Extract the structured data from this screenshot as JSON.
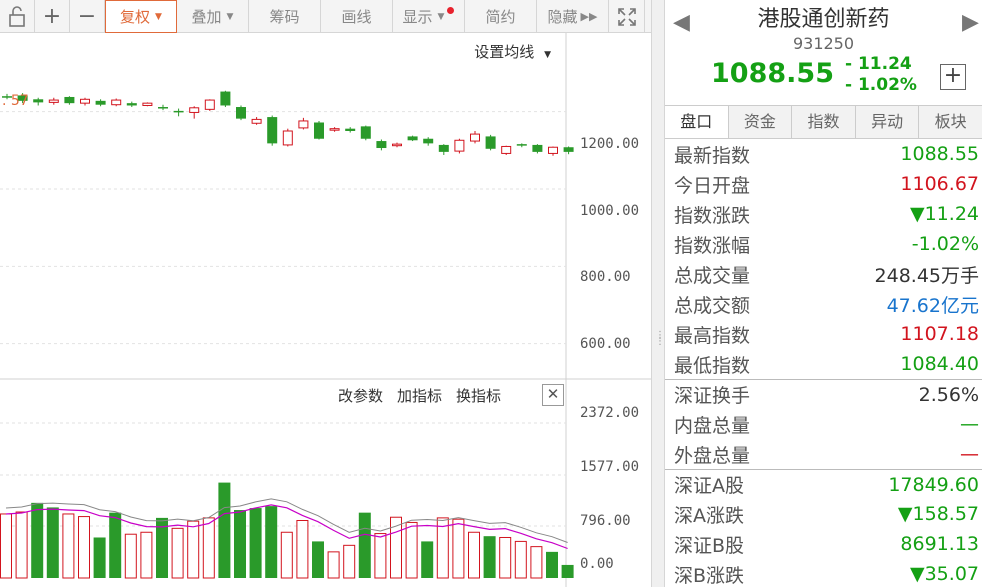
{
  "toolbar": {
    "fuquan": "复权",
    "diejia": "叠加",
    "chouma": "筹码",
    "huaxian": "画线",
    "xianshi": "显示",
    "jianyue": "简约",
    "yincang": "隐藏"
  },
  "chart": {
    "ma_setting": "设置均线",
    "last_price_label": ". 57",
    "indicator_buttons": [
      "改参数",
      "加指标",
      "换指标"
    ],
    "price_axis": [
      "1200.00",
      "1000.00",
      "800.00",
      "600.00"
    ],
    "volume_axis": [
      "2372.00",
      "1577.00",
      "796.00",
      "0.00"
    ]
  },
  "chart_data": {
    "type": "candlestick",
    "price_ylim": [
      550,
      1300
    ],
    "volume_ylim": [
      0,
      2372
    ],
    "candles": [
      {
        "o": 1240,
        "c": 1238,
        "h": 1246,
        "l": 1232,
        "dir": "down"
      },
      {
        "o": 1242,
        "c": 1228,
        "h": 1248,
        "l": 1222,
        "dir": "down"
      },
      {
        "o": 1232,
        "c": 1224,
        "h": 1236,
        "l": 1216,
        "dir": "down"
      },
      {
        "o": 1224,
        "c": 1230,
        "h": 1236,
        "l": 1218,
        "dir": "up"
      },
      {
        "o": 1238,
        "c": 1222,
        "h": 1240,
        "l": 1218,
        "dir": "down"
      },
      {
        "o": 1222,
        "c": 1232,
        "h": 1236,
        "l": 1216,
        "dir": "up"
      },
      {
        "o": 1228,
        "c": 1218,
        "h": 1232,
        "l": 1214,
        "dir": "down"
      },
      {
        "o": 1218,
        "c": 1230,
        "h": 1234,
        "l": 1214,
        "dir": "up"
      },
      {
        "o": 1222,
        "c": 1216,
        "h": 1226,
        "l": 1212,
        "dir": "down"
      },
      {
        "o": 1216,
        "c": 1222,
        "h": 1224,
        "l": 1214,
        "dir": "up"
      },
      {
        "o": 1212,
        "c": 1210,
        "h": 1218,
        "l": 1204,
        "dir": "down"
      },
      {
        "o": 1200,
        "c": 1202,
        "h": 1208,
        "l": 1188,
        "dir": "down"
      },
      {
        "o": 1198,
        "c": 1210,
        "h": 1214,
        "l": 1182,
        "dir": "up"
      },
      {
        "o": 1206,
        "c": 1230,
        "h": 1232,
        "l": 1202,
        "dir": "up"
      },
      {
        "o": 1216,
        "c": 1252,
        "h": 1254,
        "l": 1212,
        "dir": "down"
      },
      {
        "o": 1212,
        "c": 1182,
        "h": 1216,
        "l": 1178,
        "dir": "down"
      },
      {
        "o": 1170,
        "c": 1180,
        "h": 1186,
        "l": 1166,
        "dir": "up"
      },
      {
        "o": 1186,
        "c": 1118,
        "h": 1190,
        "l": 1112,
        "dir": "down"
      },
      {
        "o": 1114,
        "c": 1150,
        "h": 1156,
        "l": 1110,
        "dir": "up"
      },
      {
        "o": 1158,
        "c": 1176,
        "h": 1184,
        "l": 1154,
        "dir": "up"
      },
      {
        "o": 1172,
        "c": 1130,
        "h": 1176,
        "l": 1128,
        "dir": "down"
      },
      {
        "o": 1154,
        "c": 1156,
        "h": 1160,
        "l": 1148,
        "dir": "up"
      },
      {
        "o": 1156,
        "c": 1150,
        "h": 1160,
        "l": 1146,
        "dir": "down"
      },
      {
        "o": 1162,
        "c": 1130,
        "h": 1164,
        "l": 1126,
        "dir": "down"
      },
      {
        "o": 1124,
        "c": 1106,
        "h": 1128,
        "l": 1100,
        "dir": "down"
      },
      {
        "o": 1112,
        "c": 1116,
        "h": 1120,
        "l": 1108,
        "dir": "up"
      },
      {
        "o": 1136,
        "c": 1126,
        "h": 1138,
        "l": 1124,
        "dir": "down"
      },
      {
        "o": 1130,
        "c": 1118,
        "h": 1134,
        "l": 1112,
        "dir": "down"
      },
      {
        "o": 1114,
        "c": 1096,
        "h": 1116,
        "l": 1088,
        "dir": "down"
      },
      {
        "o": 1098,
        "c": 1126,
        "h": 1130,
        "l": 1092,
        "dir": "up"
      },
      {
        "o": 1124,
        "c": 1142,
        "h": 1150,
        "l": 1118,
        "dir": "up"
      },
      {
        "o": 1136,
        "c": 1104,
        "h": 1140,
        "l": 1100,
        "dir": "down"
      },
      {
        "o": 1092,
        "c": 1110,
        "h": 1112,
        "l": 1088,
        "dir": "up"
      },
      {
        "o": 1114,
        "c": 1116,
        "h": 1118,
        "l": 1108,
        "dir": "down"
      },
      {
        "o": 1114,
        "c": 1096,
        "h": 1116,
        "l": 1092,
        "dir": "down"
      },
      {
        "o": 1092,
        "c": 1108,
        "h": 1110,
        "l": 1086,
        "dir": "up"
      },
      {
        "o": 1096,
        "c": 1108,
        "h": 1110,
        "l": 1090,
        "dir": "down"
      }
    ],
    "volumes": [
      {
        "v": 980,
        "dir": "up"
      },
      {
        "v": 1010,
        "dir": "up"
      },
      {
        "v": 1150,
        "dir": "down"
      },
      {
        "v": 1080,
        "dir": "down"
      },
      {
        "v": 980,
        "dir": "up"
      },
      {
        "v": 940,
        "dir": "up"
      },
      {
        "v": 620,
        "dir": "down"
      },
      {
        "v": 1000,
        "dir": "down"
      },
      {
        "v": 670,
        "dir": "up"
      },
      {
        "v": 700,
        "dir": "up"
      },
      {
        "v": 920,
        "dir": "down"
      },
      {
        "v": 760,
        "dir": "up"
      },
      {
        "v": 870,
        "dir": "up"
      },
      {
        "v": 920,
        "dir": "up"
      },
      {
        "v": 1460,
        "dir": "down"
      },
      {
        "v": 1040,
        "dir": "down"
      },
      {
        "v": 1070,
        "dir": "down"
      },
      {
        "v": 1100,
        "dir": "down"
      },
      {
        "v": 700,
        "dir": "up"
      },
      {
        "v": 880,
        "dir": "up"
      },
      {
        "v": 560,
        "dir": "down"
      },
      {
        "v": 400,
        "dir": "up"
      },
      {
        "v": 500,
        "dir": "up"
      },
      {
        "v": 1000,
        "dir": "down"
      },
      {
        "v": 680,
        "dir": "up"
      },
      {
        "v": 930,
        "dir": "up"
      },
      {
        "v": 850,
        "dir": "up"
      },
      {
        "v": 560,
        "dir": "down"
      },
      {
        "v": 920,
        "dir": "up"
      },
      {
        "v": 900,
        "dir": "up"
      },
      {
        "v": 700,
        "dir": "up"
      },
      {
        "v": 640,
        "dir": "down"
      },
      {
        "v": 620,
        "dir": "up"
      },
      {
        "v": 560,
        "dir": "up"
      },
      {
        "v": 480,
        "dir": "up"
      },
      {
        "v": 400,
        "dir": "down"
      },
      {
        "v": 200,
        "dir": "down"
      }
    ]
  },
  "panel": {
    "title": "港股通创新药",
    "code": "931250",
    "price": "1088.55",
    "change": "- 11.24",
    "change_pct": "- 1.02%",
    "tabs": [
      "盘口",
      "资金",
      "指数",
      "异动",
      "板块"
    ],
    "rows": [
      {
        "label": "最新指数",
        "value": "1088.55",
        "color": "green"
      },
      {
        "label": "今日开盘",
        "value": "1106.67",
        "color": "red"
      },
      {
        "label": "指数涨跌",
        "value": "▼11.24",
        "color": "green"
      },
      {
        "label": "指数涨幅",
        "value": "-1.02%",
        "color": "green"
      },
      {
        "label": "总成交量",
        "value": "248.45万手",
        "color": "dark"
      },
      {
        "label": "总成交额",
        "value": "47.62亿元",
        "color": "blue"
      },
      {
        "label": "最高指数",
        "value": "1107.18",
        "color": "red"
      },
      {
        "label": "最低指数",
        "value": "1084.40",
        "color": "green"
      },
      {
        "label": "深证换手",
        "value": "2.56%",
        "color": "dark",
        "sep": true
      },
      {
        "label": "内盘总量",
        "value": "—",
        "color": "green"
      },
      {
        "label": "外盘总量",
        "value": "—",
        "color": "red"
      },
      {
        "label": "深证A股",
        "value": "17849.60",
        "color": "green",
        "sep": true
      },
      {
        "label": "深A涨跌",
        "value": "▼158.57",
        "color": "green"
      },
      {
        "label": "深证B股",
        "value": "8691.13",
        "color": "green"
      },
      {
        "label": "深B涨跌",
        "value": "▼35.07",
        "color": "green"
      }
    ]
  }
}
